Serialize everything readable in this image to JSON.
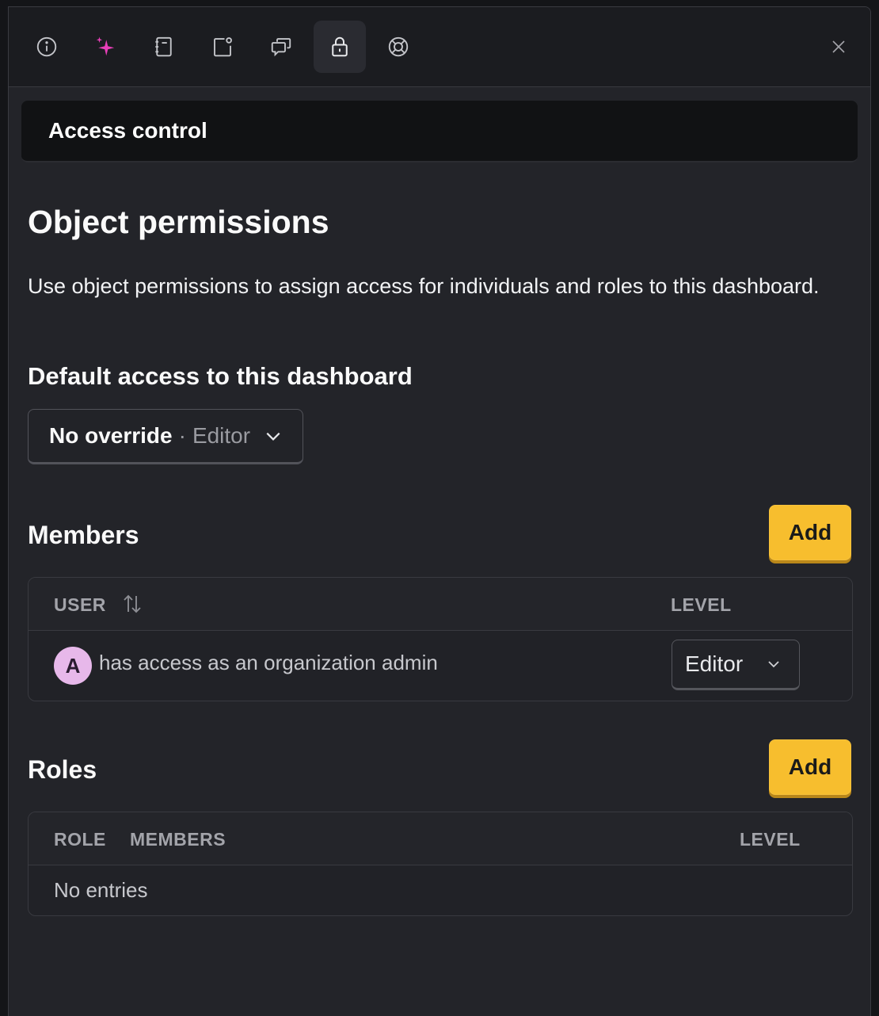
{
  "toolbar": {
    "tabs": [
      {
        "icon": "info-icon"
      },
      {
        "icon": "sparkles-icon",
        "color": "#e83fb8"
      },
      {
        "icon": "notebook-icon"
      },
      {
        "icon": "notification-square-icon"
      },
      {
        "icon": "discussion-icon"
      },
      {
        "icon": "lock-icon",
        "active": true
      },
      {
        "icon": "support-icon"
      }
    ],
    "close_icon": "close-icon"
  },
  "section": {
    "title": "Access control"
  },
  "permissions": {
    "title": "Object permissions",
    "description": "Use object permissions to assign access for individuals and roles to this dashboard.",
    "default_access_title": "Default access to this dashboard",
    "default_access": {
      "value": "No override",
      "separator": "·",
      "level": "Editor"
    }
  },
  "members": {
    "title": "Members",
    "add_label": "Add",
    "columns": {
      "user": "USER",
      "level": "LEVEL"
    },
    "rows": [
      {
        "avatar": "A",
        "text": "has access as an organization admin",
        "level": "Editor"
      }
    ]
  },
  "roles": {
    "title": "Roles",
    "add_label": "Add",
    "columns": {
      "role": "ROLE",
      "members": "MEMBERS",
      "level": "LEVEL"
    },
    "empty": "No entries"
  },
  "colors": {
    "accent": "#f7be2e",
    "background": "#232429",
    "sparkle": "#e83fb8",
    "avatar": "#e7b8ea"
  }
}
